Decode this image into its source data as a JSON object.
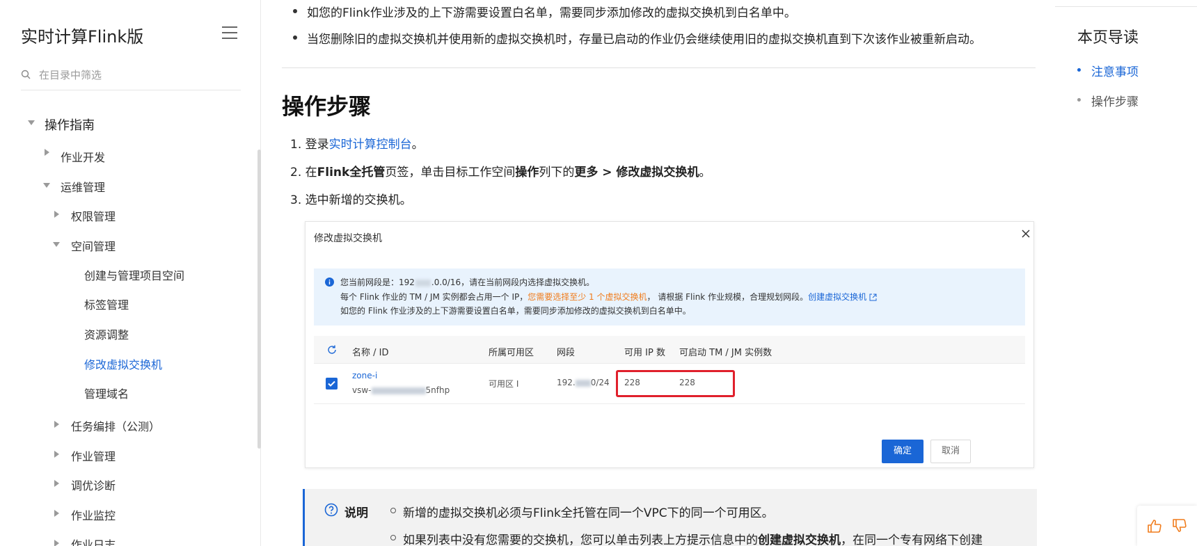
{
  "sidebar": {
    "title": "实时计算Flink版",
    "search_placeholder": "在目录中筛选",
    "items": [
      {
        "label": "操作指南"
      },
      {
        "label": "作业开发"
      },
      {
        "label": "运维管理"
      },
      {
        "label": "权限管理"
      },
      {
        "label": "空间管理"
      },
      {
        "label": "创建与管理项目空间"
      },
      {
        "label": "标签管理"
      },
      {
        "label": "资源调整"
      },
      {
        "label": "修改虚拟交换机"
      },
      {
        "label": "管理域名"
      },
      {
        "label": "任务编排（公测）"
      },
      {
        "label": "作业管理"
      },
      {
        "label": "调优诊断"
      },
      {
        "label": "作业监控"
      },
      {
        "label": "作业日志"
      }
    ]
  },
  "main": {
    "bullets": [
      "如您的Flink作业涉及的上下游需要设置白名单，需要同步添加修改的虚拟交换机到白名单中。",
      "当您删除旧的虚拟交换机并使用新的虚拟交换机时，存量已启动的作业仍会继续使用旧的虚拟交换机直到下次该作业被重新启动。"
    ],
    "heading": "操作步骤",
    "step1": {
      "num": "1.",
      "pre": "登录",
      "link": "实时计算控制台",
      "post": "。"
    },
    "step2": {
      "num": "2.",
      "pre": "在",
      "b1": "Flink全托管",
      "mid1": "页签，单击目标工作空间",
      "b2": "操作",
      "mid2": "列下的",
      "b3": "更多 > 修改虚拟交换机",
      "post": "。"
    },
    "step3": {
      "num": "3.",
      "text": "选中新增的交换机。"
    },
    "dialog": {
      "title": "修改虚拟交换机",
      "notice_l1_a": "您当前网段是：192",
      "notice_l1_b": ".0.0/16，请在当前网段内选择虚拟交换机。",
      "notice_l2_a": "每个 Flink 作业的 TM / JM 实例都会占用一个 IP，",
      "notice_l2_warn": "您需要选择至少 1 个虚拟交换机",
      "notice_l2_b": "，  请根据 Flink 作业规模，合理规划网段。",
      "notice_l2_link": "创建虚拟交换机",
      "notice_l3": "如您的 Flink 作业涉及的上下游需要设置白名单，需要同步添加修改的虚拟交换机到白名单中。",
      "columns": [
        "名称 / ID",
        "所属可用区",
        "网段",
        "可用 IP 数",
        "可启动 TM / JM 实例数"
      ],
      "row": {
        "name": "zone-i",
        "id_prefix": "vsw-",
        "id_suffix": "5nfhp",
        "zone": "可用区 I",
        "cidr_prefix": "192.",
        "cidr_suffix": "0/24",
        "ips": "228",
        "instances": "228"
      },
      "ok": "确定",
      "cancel": "取消"
    },
    "note": {
      "label": "说明",
      "item1": "新增的虚拟交换机必须与Flink全托管在同一个VPC下的同一个可用区。",
      "item2_pre": "如果列表中没有您需要的交换机，您可以单击列表上方提示信息中的",
      "item2_bold": "创建虚拟交换机",
      "item2_post": "，在同一个专有网络下创建"
    }
  },
  "toc": {
    "title": "本页导读",
    "items": [
      "注意事项",
      "操作步骤"
    ]
  },
  "colors": {
    "accent": "#1a66d6",
    "warning": "#f07c1c",
    "highlight": "#e0202c"
  }
}
